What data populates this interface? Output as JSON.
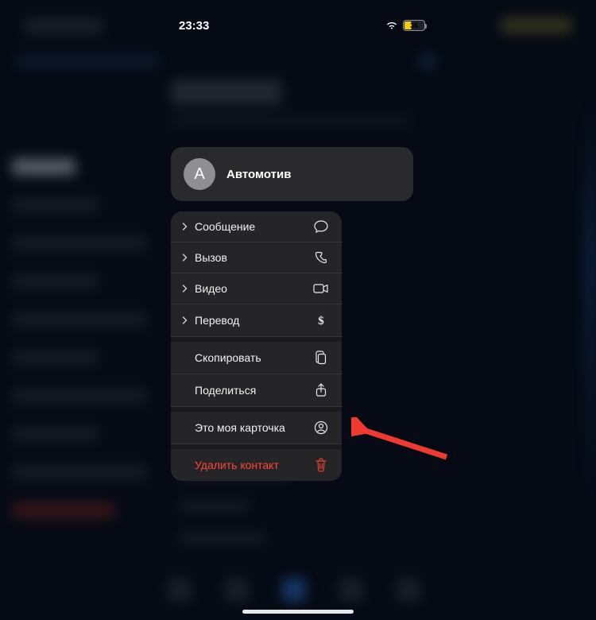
{
  "status": {
    "time": "23:33",
    "battery_percent": "36"
  },
  "contact": {
    "avatar_initial": "А",
    "name": "Автомотив"
  },
  "menu": {
    "message": "Сообщение",
    "call": "Вызов",
    "video": "Видео",
    "transfer": "Перевод",
    "copy": "Скопировать",
    "share": "Поделиться",
    "my_card": "Это моя карточка",
    "delete": "Удалить контакт"
  },
  "colors": {
    "destructive": "#ff453a",
    "card_bg": "#2a2a2c",
    "menu_bg": "#252527",
    "arrow": "#ef3b2f"
  }
}
